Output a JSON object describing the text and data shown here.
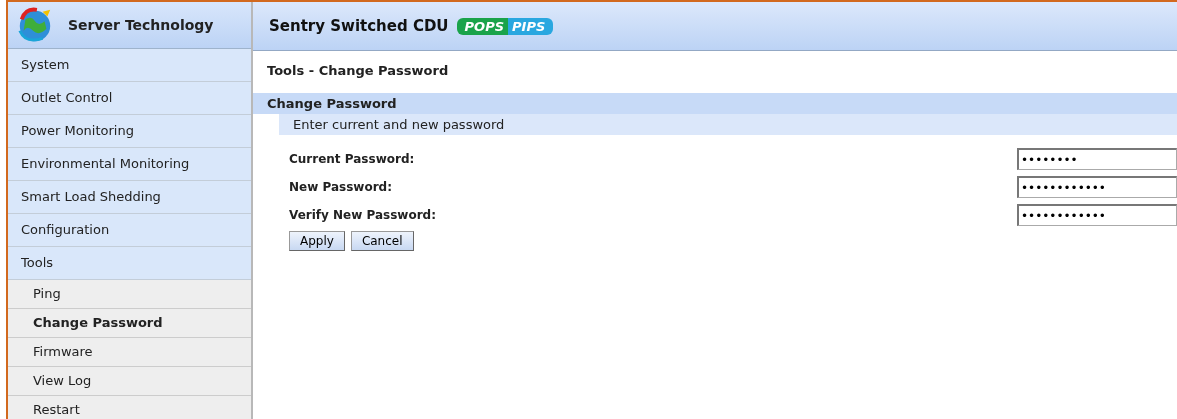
{
  "brand": {
    "name": "Server Technology"
  },
  "header": {
    "title": "Sentry Switched CDU",
    "badge_left": "POPS",
    "badge_right": "PIPS"
  },
  "sidebar": {
    "items": [
      {
        "label": "System",
        "selected": false
      },
      {
        "label": "Outlet Control",
        "selected": false
      },
      {
        "label": "Power Monitoring",
        "selected": false
      },
      {
        "label": "Environmental Monitoring",
        "selected": false
      },
      {
        "label": "Smart Load Shedding",
        "selected": false
      },
      {
        "label": "Configuration",
        "selected": false
      },
      {
        "label": "Tools",
        "selected": false,
        "children": [
          {
            "label": "Ping",
            "selected": false
          },
          {
            "label": "Change Password",
            "selected": true
          },
          {
            "label": "Firmware",
            "selected": false
          },
          {
            "label": "View Log",
            "selected": false
          },
          {
            "label": "Restart",
            "selected": false
          }
        ]
      }
    ]
  },
  "breadcrumb": "Tools - Change Password",
  "section": {
    "title": "Change Password",
    "subtitle": "Enter current and new password"
  },
  "fields": [
    {
      "label": "Current Password:",
      "value": "••••••••"
    },
    {
      "label": "New Password:",
      "value": "••••••••••••"
    },
    {
      "label": "Verify New Password:",
      "value": "••••••••••••"
    }
  ],
  "buttons": [
    "Apply",
    "Cancel"
  ]
}
